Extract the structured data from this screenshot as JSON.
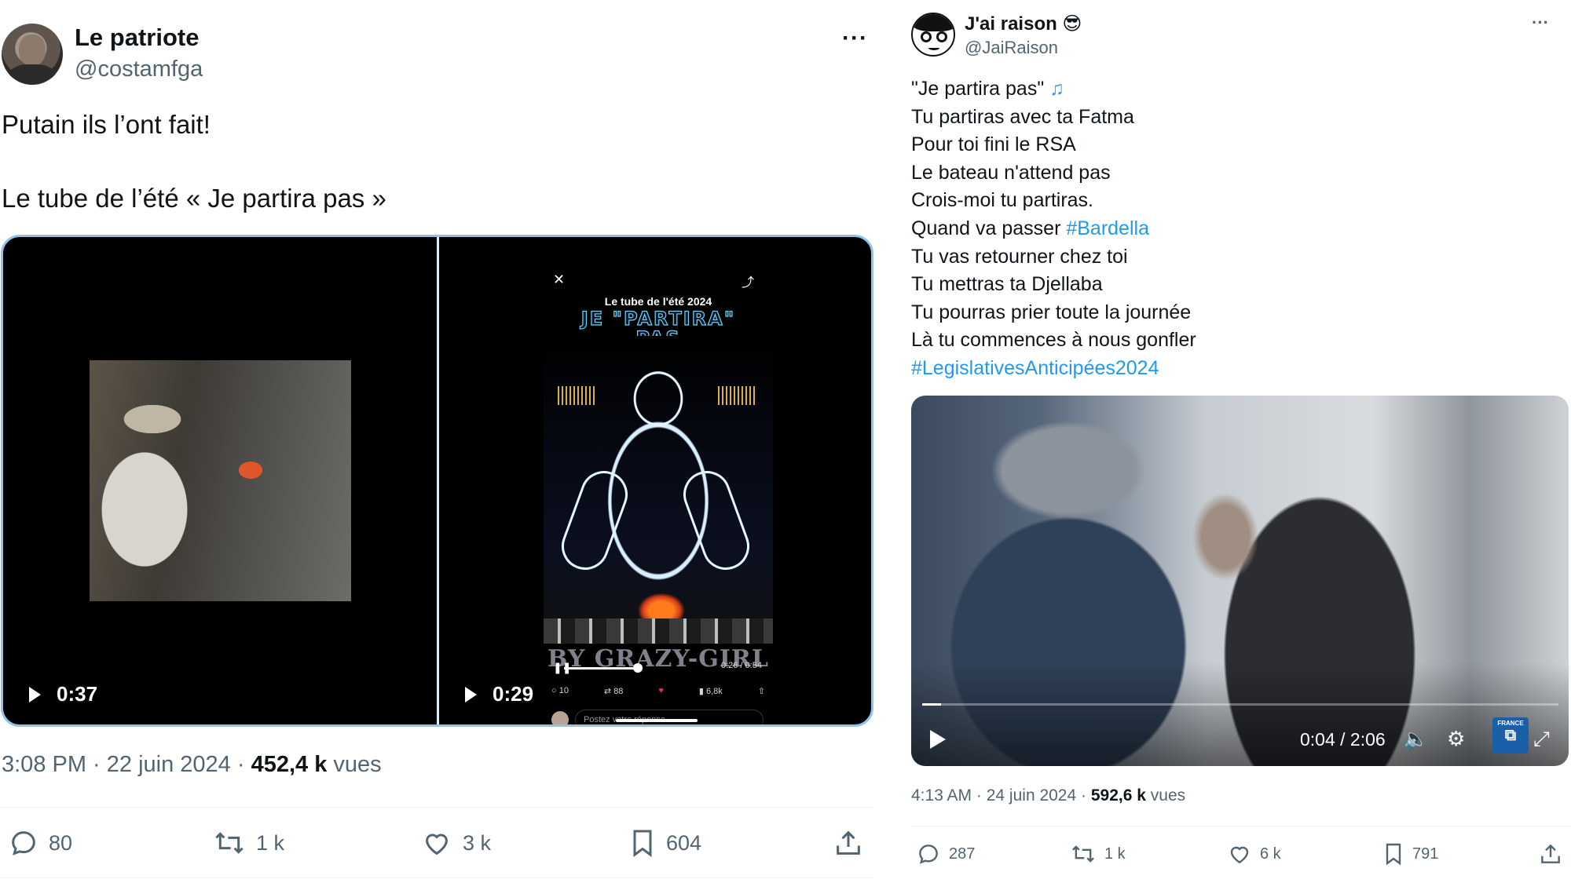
{
  "tweet_left": {
    "display_name": "Le patriote",
    "handle": "@costamfga",
    "more_label": "···",
    "text_line_1": "Putain ils l’ont fait!",
    "text_line_2": "Le tube de l’été « Je partira pas »",
    "media": {
      "video_a": {
        "duration": "0:37"
      },
      "video_b": {
        "duration": "0:29",
        "close_glyph": "✕",
        "inner_caption": "Le tube de l'été 2024",
        "inner_title_line_1": "JE \"PARTIRA\"",
        "inner_title_line_2": "PAS",
        "inner_watermark": "BY GRAZY-GIRL",
        "inner_time": "0:26 / 0:54",
        "inner_replies": "10",
        "inner_reposts": "88",
        "inner_views": "6,8k",
        "inner_reply_placeholder": "Postez votre réponse",
        "inner_progress_fraction": 0.48
      }
    },
    "time": "3:08 PM",
    "date": "22 juin 2024",
    "views_count": "452,4 k",
    "views_label": "vues",
    "replies": "80",
    "reposts": "1 k",
    "likes": "3 k",
    "bookmarks": "604"
  },
  "tweet_right": {
    "display_name": "J'ai raison 😎",
    "handle": "@JaiRaison",
    "more_label": "···",
    "poem": {
      "line_1": "\"Je partira pas\" ",
      "line_1_note": "♫",
      "line_2": "Tu partiras avec ta Fatma",
      "line_3": "Pour toi fini le RSA",
      "line_4": "Le bateau n'attend pas",
      "line_5": "Crois-moi tu partiras.",
      "line_6_text": "Quand va passer ",
      "line_6_tag": "#Bardella",
      "line_7": "Tu vas retourner chez toi",
      "line_8": "Tu mettras ta Djellaba",
      "line_9": "Tu pourras prier toute la journée",
      "line_10": "Là tu commences à nous gonfler",
      "line_11_tag": "#LegislativesAnticipées2024"
    },
    "video": {
      "time": "0:04 / 2:06",
      "progress_fraction": 0.03,
      "channel_logo": "FRANCE"
    },
    "time": "4:13 AM",
    "date": "24 juin 2024",
    "views_count": "592,6 k",
    "views_label": "vues",
    "replies": "287",
    "reposts": "1 k",
    "likes": "6 k",
    "bookmarks": "791"
  },
  "colors": {
    "text": "#0f1419",
    "secondary": "#536471",
    "link": "#1d9bf0",
    "media_focus_border": "#8ec3f0"
  }
}
